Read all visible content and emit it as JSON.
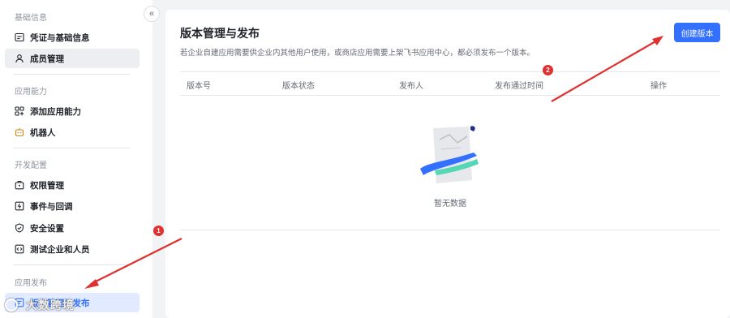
{
  "sidebar": {
    "groups": [
      {
        "title": "基础信息",
        "items": [
          {
            "label": "凭证与基础信息"
          },
          {
            "label": "成员管理"
          }
        ]
      },
      {
        "title": "应用能力",
        "items": [
          {
            "label": "添加应用能力"
          },
          {
            "label": "机器人"
          }
        ]
      },
      {
        "title": "开发配置",
        "items": [
          {
            "label": "权限管理"
          },
          {
            "label": "事件与回调"
          },
          {
            "label": "安全设置"
          },
          {
            "label": "测试企业和人员"
          }
        ]
      },
      {
        "title": "应用发布",
        "items": [
          {
            "label": "版本管理与发布"
          }
        ]
      }
    ],
    "collapse_glyph": "«"
  },
  "main": {
    "title": "版本管理与发布",
    "description": "若企业自建应用需要供企业内其他用户使用，或商店应用需要上架飞书应用中心，都必须发布一个版本。",
    "create_button": "创建版本",
    "table": {
      "columns": [
        "版本号",
        "版本状态",
        "发布人",
        "发布通过时间",
        "操作"
      ],
      "rows": [],
      "empty_text": "暂无数据"
    }
  },
  "annotations": {
    "badge_1": "1",
    "badge_2": "2",
    "color": "#e03131"
  },
  "watermark": {
    "text": "大数跨境"
  },
  "colors": {
    "accent": "#3370ff",
    "active_bg": "#e1eaff",
    "page_bg": "#f2f3f5"
  }
}
